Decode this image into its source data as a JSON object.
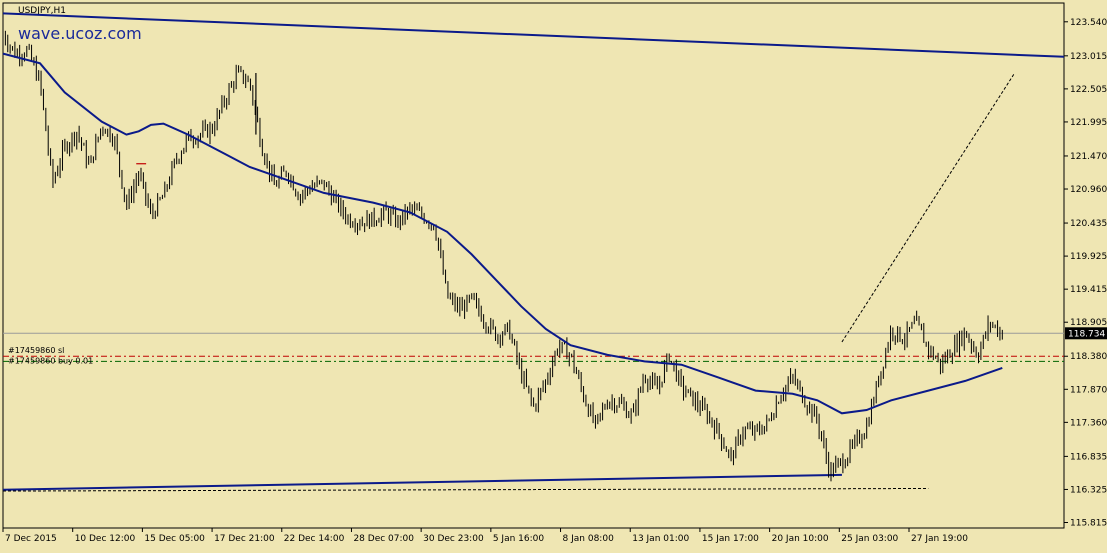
{
  "chart_data": {
    "type": "candlestick",
    "symbol_label": "USDJPY,H1",
    "watermark": "wave.ucoz.com",
    "y_ticks": [
      "123.540",
      "123.015",
      "122.505",
      "121.995",
      "121.470",
      "120.960",
      "120.435",
      "119.925",
      "119.415",
      "118.905",
      "118.380",
      "117.870",
      "117.360",
      "116.835",
      "116.325",
      "115.815"
    ],
    "y_tick_values": [
      123.54,
      123.015,
      122.505,
      121.995,
      121.47,
      120.96,
      120.435,
      119.925,
      119.415,
      118.905,
      118.38,
      117.87,
      117.36,
      116.835,
      116.325,
      115.815
    ],
    "x_ticks": [
      "7 Dec 2015",
      "10 Dec 12:00",
      "15 Dec 05:00",
      "17 Dec 21:00",
      "22 Dec 14:00",
      "28 Dec 07:00",
      "30 Dec 23:00",
      "5 Jan 16:00",
      "8 Jan 08:00",
      "13 Jan 01:00",
      "15 Jan 17:00",
      "20 Jan 10:00",
      "25 Jan 03:00",
      "27 Jan 19:00"
    ],
    "ylim": [
      115.73,
      123.83
    ],
    "current_price": "118.734",
    "current_price_value": 118.734,
    "order_labels": [
      "#17459860 sl",
      "#17459860 buy 0.01"
    ],
    "order_levels": [
      118.38,
      118.3
    ],
    "price_path": [
      [
        0,
        123.35
      ],
      [
        1,
        123.05
      ],
      [
        2,
        123.1
      ],
      [
        3,
        122.6
      ],
      [
        4,
        121.05
      ],
      [
        5,
        121.6
      ],
      [
        6,
        121.85
      ],
      [
        7,
        121.3
      ],
      [
        8,
        121.95
      ],
      [
        9,
        121.75
      ],
      [
        10,
        120.7
      ],
      [
        11,
        121.2
      ],
      [
        12,
        120.55
      ],
      [
        13,
        120.85
      ],
      [
        14,
        121.4
      ],
      [
        15,
        121.75
      ],
      [
        16,
        121.8
      ],
      [
        17,
        121.9
      ],
      [
        18,
        122.35
      ],
      [
        19,
        122.75
      ],
      [
        20,
        122.6
      ],
      [
        21,
        121.6
      ],
      [
        22,
        121.0
      ],
      [
        23,
        121.25
      ],
      [
        24,
        120.85
      ],
      [
        25,
        121.0
      ],
      [
        26,
        121.05
      ],
      [
        27,
        120.75
      ],
      [
        28,
        120.5
      ],
      [
        29,
        120.45
      ],
      [
        30,
        120.5
      ],
      [
        31,
        120.6
      ],
      [
        32,
        120.45
      ],
      [
        33,
        120.65
      ],
      [
        34,
        120.55
      ],
      [
        35,
        120.4
      ],
      [
        36,
        119.3
      ],
      [
        37,
        119.1
      ],
      [
        38,
        119.25
      ],
      [
        39,
        118.95
      ],
      [
        40,
        118.7
      ],
      [
        41,
        118.8
      ],
      [
        42,
        118.1
      ],
      [
        43,
        117.6
      ],
      [
        44,
        118.0
      ],
      [
        45,
        118.55
      ],
      [
        46,
        118.4
      ],
      [
        47,
        117.8
      ],
      [
        48,
        117.3
      ],
      [
        49,
        117.7
      ],
      [
        50,
        117.65
      ],
      [
        51,
        117.45
      ],
      [
        52,
        118.1
      ],
      [
        53,
        117.85
      ],
      [
        54,
        118.4
      ],
      [
        55,
        117.9
      ],
      [
        56,
        117.7
      ],
      [
        57,
        117.5
      ],
      [
        58,
        117.2
      ],
      [
        59,
        116.8
      ],
      [
        60,
        117.25
      ],
      [
        61,
        117.2
      ],
      [
        62,
        117.35
      ],
      [
        63,
        117.8
      ],
      [
        64,
        118.05
      ],
      [
        65,
        117.7
      ],
      [
        66,
        117.4
      ],
      [
        67,
        116.6
      ],
      [
        68,
        116.75
      ],
      [
        69,
        117.0
      ],
      [
        70,
        117.3
      ],
      [
        71,
        118.05
      ],
      [
        72,
        118.8
      ],
      [
        73,
        118.65
      ],
      [
        74,
        118.9
      ],
      [
        75,
        118.5
      ],
      [
        76,
        118.25
      ],
      [
        77,
        118.5
      ],
      [
        78,
        118.75
      ],
      [
        79,
        118.4
      ],
      [
        80,
        118.9
      ],
      [
        81,
        118.73
      ]
    ],
    "ma_path": [
      [
        0,
        123.05
      ],
      [
        3,
        122.9
      ],
      [
        5,
        122.45
      ],
      [
        8,
        122.0
      ],
      [
        10,
        121.8
      ],
      [
        11,
        121.85
      ],
      [
        12,
        121.95
      ],
      [
        13,
        121.97
      ],
      [
        15,
        121.8
      ],
      [
        18,
        121.5
      ],
      [
        20,
        121.3
      ],
      [
        23,
        121.1
      ],
      [
        26,
        120.9
      ],
      [
        30,
        120.75
      ],
      [
        33,
        120.6
      ],
      [
        36,
        120.3
      ],
      [
        38,
        119.95
      ],
      [
        40,
        119.55
      ],
      [
        42,
        119.15
      ],
      [
        44,
        118.8
      ],
      [
        46,
        118.55
      ],
      [
        49,
        118.4
      ],
      [
        52,
        118.3
      ],
      [
        55,
        118.25
      ],
      [
        58,
        118.05
      ],
      [
        61,
        117.85
      ],
      [
        64,
        117.8
      ],
      [
        66,
        117.7
      ],
      [
        68,
        117.5
      ],
      [
        70,
        117.55
      ],
      [
        72,
        117.7
      ],
      [
        75,
        117.85
      ],
      [
        78,
        118.0
      ],
      [
        81,
        118.2
      ]
    ],
    "trendlines": [
      {
        "from": [
          0,
          123.67
        ],
        "to": [
          86,
          123.0
        ],
        "style": "solid",
        "color": "#0b1a8a"
      },
      {
        "from": [
          0,
          116.32
        ],
        "to": [
          68,
          116.55
        ],
        "style": "solid",
        "color": "#0b1a8a"
      },
      {
        "from": [
          0,
          116.3
        ],
        "to": [
          75,
          116.34
        ],
        "style": "dotted",
        "color": "#000000"
      },
      {
        "from": [
          68,
          118.6
        ],
        "to": [
          82,
          122.75
        ],
        "style": "dotted",
        "color": "#000000"
      }
    ],
    "colors": {
      "background": "#efe6b3",
      "candles": "#000000",
      "ma": "#0b1a8a",
      "sl_line": "#c00000",
      "buy_line": "#006400",
      "price_marker": "#000000"
    }
  }
}
